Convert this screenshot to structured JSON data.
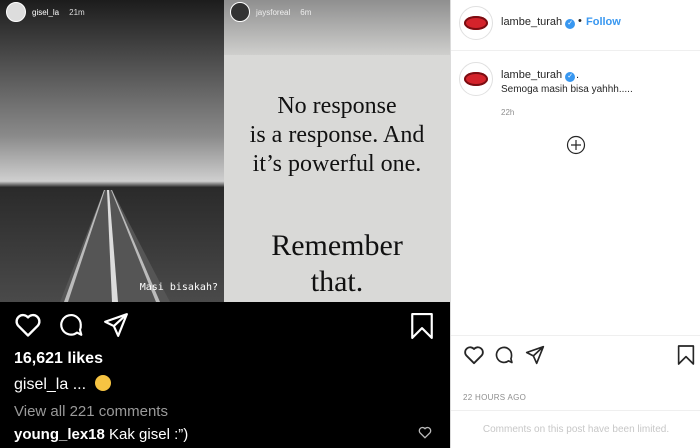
{
  "stories": [
    {
      "username": "gisel_la",
      "time": "21m",
      "caption": "Masi bisakah?"
    },
    {
      "username": "jaysforeal",
      "time": "6m",
      "quote_lines": [
        "No response",
        "is a response. And",
        "it’s powerful one."
      ],
      "quote_lines2": [
        "Remember",
        "that."
      ]
    }
  ],
  "left_post": {
    "likes": "16,621 likes",
    "caption_user": "gisel_la",
    "caption_text": " ... ",
    "view_all": "View all 221 comments",
    "comment_user": "young_lex18",
    "comment_text": " Kak gisel :”)"
  },
  "right_post": {
    "header_user": "lambe_turah",
    "header_dot": "•",
    "follow": "Follow",
    "comment_user": "lambe_turah",
    "comment_period": ".",
    "comment_text": "Semoga masih bisa yahhh.....",
    "comment_time": "22h",
    "date": "22 HOURS AGO",
    "limited": "Comments on this post have been limited."
  },
  "icons": [
    "heart-icon",
    "comment-icon",
    "share-icon",
    "bookmark-icon",
    "plus-circle-icon",
    "verified-badge-icon"
  ]
}
